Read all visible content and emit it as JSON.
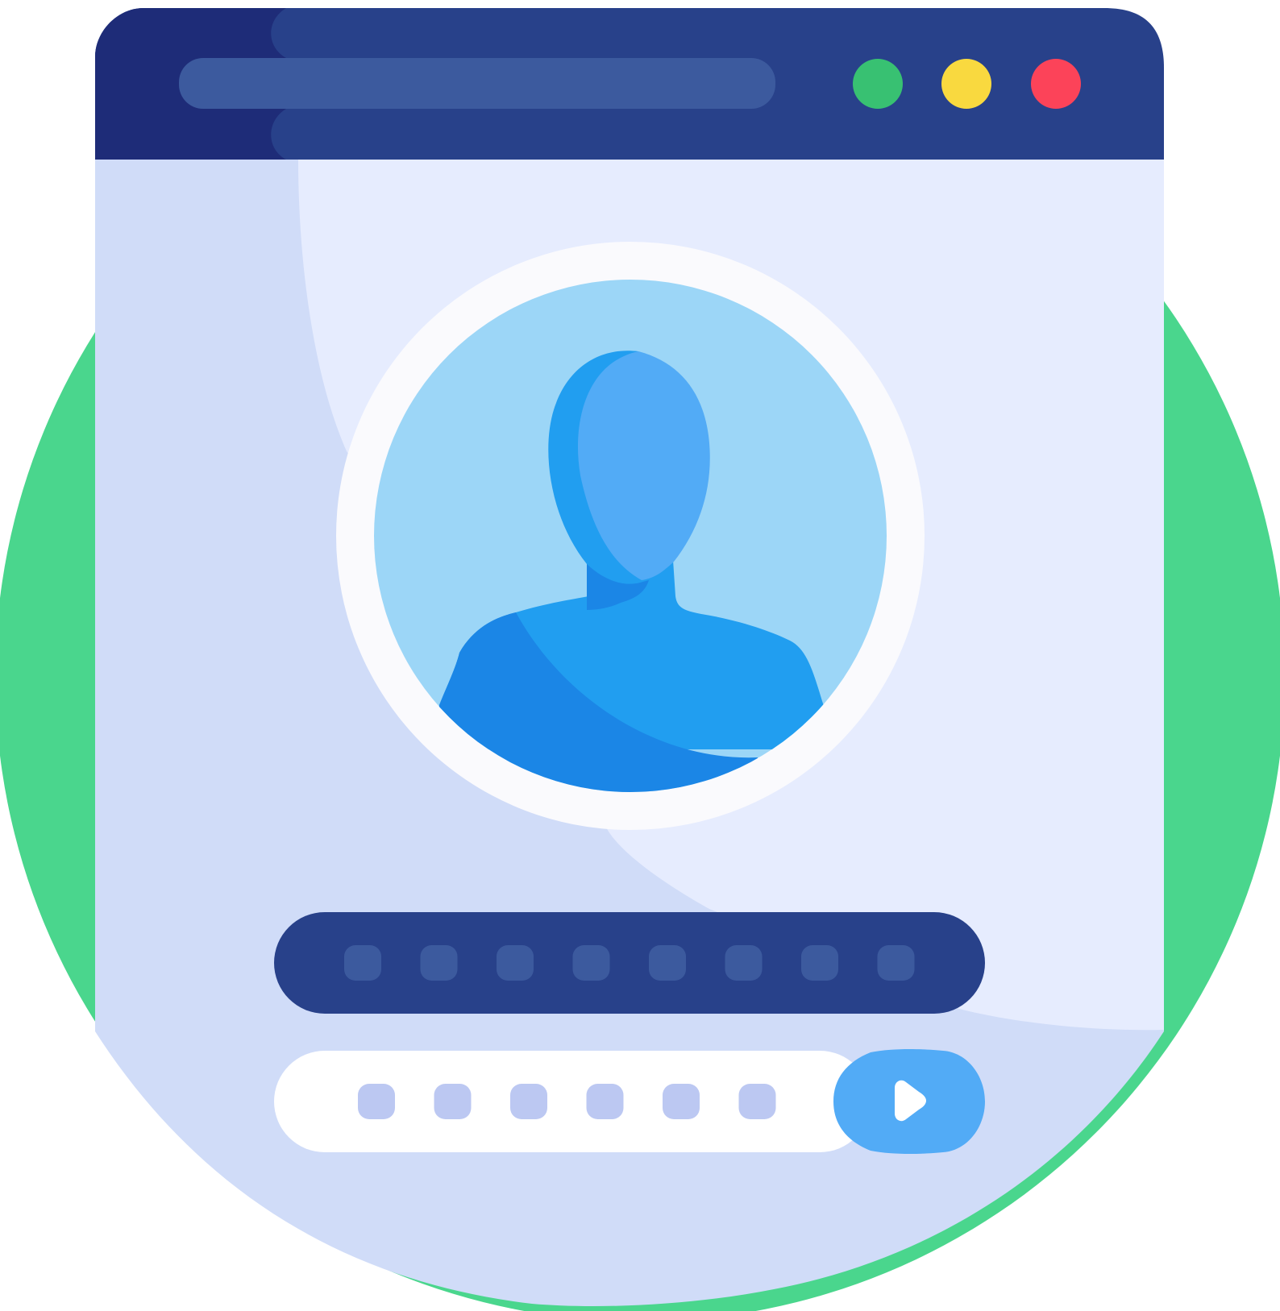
{
  "colors": {
    "background_circle": "#4AD68D",
    "window_frame_dark": "#1E2C78",
    "titlebar": "#28418A",
    "address_bar": "#3C5A9E",
    "window_body_shadow": "#D0DCF8",
    "window_body_light": "#E6ECFE",
    "avatar_ring": "#FAFAFD",
    "avatar_bg": "#9CD6F7",
    "avatar_head": "#52ABF6",
    "avatar_body": "#219EF0",
    "avatar_shadow": "#1B86E6",
    "password_bar": "#28418A",
    "password_dot": "#3C5A9E",
    "input_bar": "#FFFFFF",
    "input_dot": "#BCC8F2",
    "submit_button": "#52ABF6",
    "traffic_green": "#38C172",
    "traffic_yellow": "#F9D93F",
    "traffic_red": "#FC4359"
  },
  "window": {
    "controls": [
      "minimize",
      "maximize",
      "close"
    ]
  },
  "login": {
    "password_masked_count": 8,
    "input_masked_count": 6,
    "submit_icon": "play-icon"
  }
}
